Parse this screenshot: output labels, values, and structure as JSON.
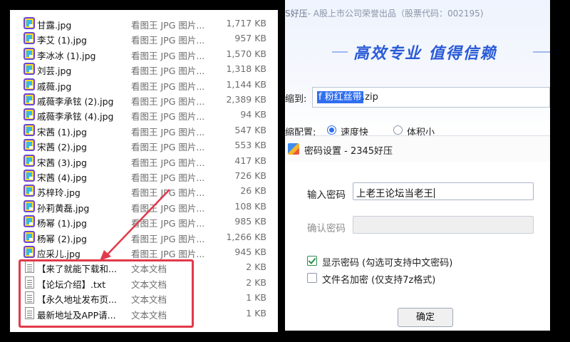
{
  "explorer": {
    "files": [
      {
        "name": "甘露.jpg",
        "type": "看图王 JPG 图片...",
        "size": "1,717 KB",
        "icon": "image-file-icon"
      },
      {
        "name": "李艾 (1).jpg",
        "type": "看图王 JPG 图片...",
        "size": "957 KB",
        "icon": "image-file-icon"
      },
      {
        "name": "李冰冰 (1).jpg",
        "type": "看图王 JPG 图片...",
        "size": "1,570 KB",
        "icon": "image-file-icon"
      },
      {
        "name": "刘芸.jpg",
        "type": "看图王 JPG 图片...",
        "size": "1,318 KB",
        "icon": "image-file-icon"
      },
      {
        "name": "戚薇.jpg",
        "type": "看图王 JPG 图片...",
        "size": "1,144 KB",
        "icon": "image-file-icon"
      },
      {
        "name": "戚薇李承铉 (2).jpg",
        "type": "看图王 JPG 图片...",
        "size": "2,389 KB",
        "icon": "image-file-icon"
      },
      {
        "name": "戚薇李承铉 (4).jpg",
        "type": "看图王 JPG 图片...",
        "size": "94 KB",
        "icon": "image-file-icon"
      },
      {
        "name": "宋茜 (1).jpg",
        "type": "看图王 JPG 图片...",
        "size": "547 KB",
        "icon": "image-file-icon"
      },
      {
        "name": "宋茜 (2).jpg",
        "type": "看图王 JPG 图片...",
        "size": "553 KB",
        "icon": "image-file-icon"
      },
      {
        "name": "宋茜 (3).jpg",
        "type": "看图王 JPG 图片...",
        "size": "417 KB",
        "icon": "image-file-icon"
      },
      {
        "name": "宋茜 (4).jpg",
        "type": "看图王 JPG 图片...",
        "size": "726 KB",
        "icon": "image-file-icon"
      },
      {
        "name": "苏梓玲.jpg",
        "type": "看图王 JPG 图片...",
        "size": "26 KB",
        "icon": "image-file-icon"
      },
      {
        "name": "孙莉黄磊.jpg",
        "type": "看图王 JPG 图片...",
        "size": "108 KB",
        "icon": "image-file-icon"
      },
      {
        "name": "杨幂 (1).jpg",
        "type": "看图王 JPG 图片...",
        "size": "985 KB",
        "icon": "image-file-icon"
      },
      {
        "name": "杨幂 (2).jpg",
        "type": "看图王 JPG 图片...",
        "size": "1,266 KB",
        "icon": "image-file-icon"
      },
      {
        "name": "应采儿.jpg",
        "type": "看图王 JPG 图片...",
        "size": "945 KB",
        "icon": "image-file-icon"
      },
      {
        "name": "【来了就能下载和...",
        "type": "文本文档",
        "size": "2 KB",
        "icon": "text-file-icon"
      },
      {
        "name": "【论坛介绍】.txt",
        "type": "文本文档",
        "size": "2 KB",
        "icon": "text-file-icon"
      },
      {
        "name": "【永久地址发布页...",
        "type": "文本文档",
        "size": "1 KB",
        "icon": "text-file-icon"
      },
      {
        "name": "最新地址及APP请...",
        "type": "文本文档",
        "size": "1 KB",
        "icon": "text-file-icon"
      }
    ],
    "highlight_color": "#e23a4a"
  },
  "app": {
    "brand_prefix": "S好压",
    "brand_line": "- A股上市公司荣誉出品（股票代码：002195)",
    "slogan": "高效专业  值得信赖",
    "compress_to_label": "缩到:",
    "compress_filename_selected": "f 粉红丝带",
    "compress_filename_ext": ".zip",
    "config_label": "缩配置:",
    "radio_fast": "速度快",
    "radio_small": "体积小",
    "accent_color": "#2a5bd7"
  },
  "dialog": {
    "title": "密码设置 - 2345好压",
    "icon": "haozip-app-icon",
    "password_label": "输入密码",
    "password_value": "上老王论坛当老王",
    "confirm_label": "确认密码",
    "show_password_label": "显示密码 (勾选可支持中文密码)",
    "show_password_checked": true,
    "encrypt_names_label": "文件名加密  (仅支持7z格式)",
    "encrypt_names_checked": false,
    "ok_label": "确定"
  }
}
